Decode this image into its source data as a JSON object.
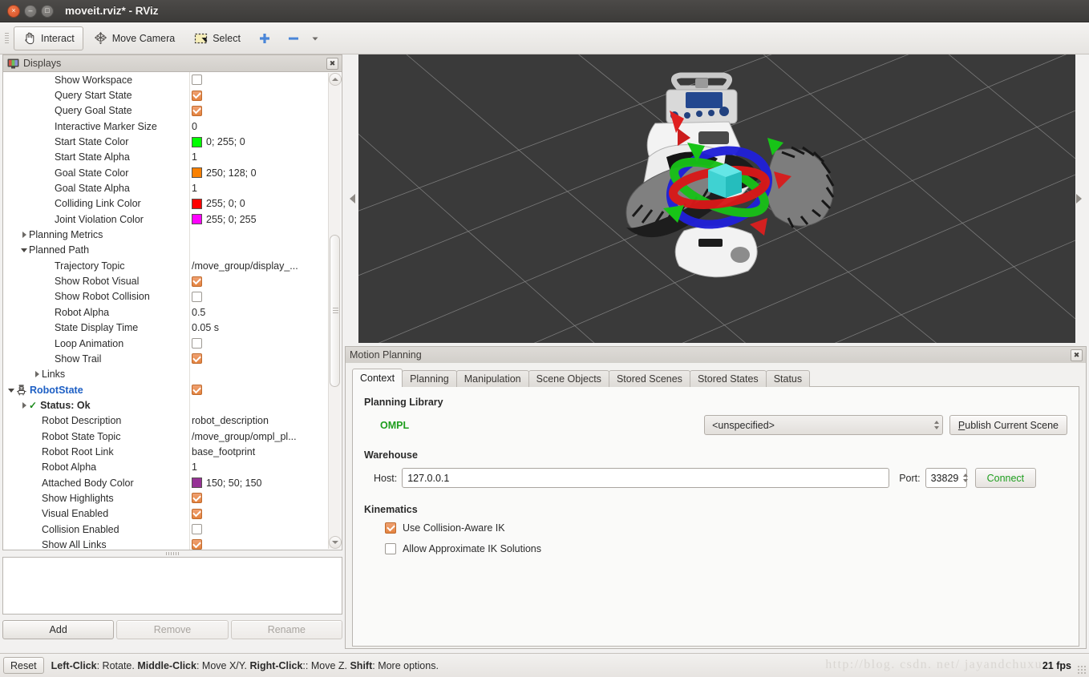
{
  "window": {
    "title": "moveit.rviz* - RViz",
    "close_label": "×",
    "minimize_label": "–",
    "maximize_label": "□"
  },
  "toolbar": {
    "interact_label": "Interact",
    "move_camera_label": "Move Camera",
    "select_label": "Select",
    "add_tool_label": "+",
    "remove_tool_label": "–",
    "dropdown_label": "▾"
  },
  "displays": {
    "panel_title": "Displays",
    "close_label": "✖",
    "value_divider_x": 232,
    "tree": [
      {
        "label": "Show Workspace",
        "indent": 3,
        "arrow": "none",
        "value_type": "checkbox",
        "checked": false
      },
      {
        "label": "Query Start State",
        "indent": 3,
        "arrow": "none",
        "value_type": "checkbox",
        "checked": true
      },
      {
        "label": "Query Goal State",
        "indent": 3,
        "arrow": "none",
        "value_type": "checkbox",
        "checked": true
      },
      {
        "label": "Interactive Marker Size",
        "indent": 3,
        "arrow": "none",
        "value_type": "text",
        "value": "0"
      },
      {
        "label": "Start State Color",
        "indent": 3,
        "arrow": "none",
        "value_type": "color",
        "value": "0; 255; 0",
        "color": "#00ff00"
      },
      {
        "label": "Start State Alpha",
        "indent": 3,
        "arrow": "none",
        "value_type": "text",
        "value": "1"
      },
      {
        "label": "Goal State Color",
        "indent": 3,
        "arrow": "none",
        "value_type": "color",
        "value": "250; 128; 0",
        "color": "#fa8000"
      },
      {
        "label": "Goal State Alpha",
        "indent": 3,
        "arrow": "none",
        "value_type": "text",
        "value": "1"
      },
      {
        "label": "Colliding Link Color",
        "indent": 3,
        "arrow": "none",
        "value_type": "color",
        "value": "255; 0; 0",
        "color": "#ff0000"
      },
      {
        "label": "Joint Violation Color",
        "indent": 3,
        "arrow": "none",
        "value_type": "color",
        "value": "255; 0; 255",
        "color": "#ff00ff"
      },
      {
        "label": "Planning Metrics",
        "indent": 1,
        "arrow": "closed",
        "value_type": "none"
      },
      {
        "label": "Planned Path",
        "indent": 1,
        "arrow": "open",
        "value_type": "none"
      },
      {
        "label": "Trajectory Topic",
        "indent": 3,
        "arrow": "none",
        "value_type": "text",
        "value": "/move_group/display_..."
      },
      {
        "label": "Show Robot Visual",
        "indent": 3,
        "arrow": "none",
        "value_type": "checkbox",
        "checked": true
      },
      {
        "label": "Show Robot Collision",
        "indent": 3,
        "arrow": "none",
        "value_type": "checkbox",
        "checked": false
      },
      {
        "label": "Robot Alpha",
        "indent": 3,
        "arrow": "none",
        "value_type": "text",
        "value": "0.5"
      },
      {
        "label": "State Display Time",
        "indent": 3,
        "arrow": "none",
        "value_type": "text",
        "value": "0.05 s"
      },
      {
        "label": "Loop Animation",
        "indent": 3,
        "arrow": "none",
        "value_type": "checkbox",
        "checked": false
      },
      {
        "label": "Show Trail",
        "indent": 3,
        "arrow": "none",
        "value_type": "checkbox",
        "checked": true
      },
      {
        "label": "Links",
        "indent": 2,
        "arrow": "closed",
        "value_type": "none"
      },
      {
        "label": "RobotState",
        "indent": 0,
        "arrow": "open",
        "value_type": "checkbox",
        "checked": true,
        "style": "display-root",
        "icon": "robot-icon"
      },
      {
        "label": "Status: Ok",
        "indent": 1,
        "arrow": "closed",
        "value_type": "none",
        "style": "status-ok"
      },
      {
        "label": "Robot Description",
        "indent": 2,
        "arrow": "none",
        "value_type": "text",
        "value": "robot_description"
      },
      {
        "label": "Robot State Topic",
        "indent": 2,
        "arrow": "none",
        "value_type": "text",
        "value": "/move_group/ompl_pl..."
      },
      {
        "label": "Robot Root Link",
        "indent": 2,
        "arrow": "none",
        "value_type": "text",
        "value": "base_footprint"
      },
      {
        "label": "Robot Alpha",
        "indent": 2,
        "arrow": "none",
        "value_type": "text",
        "value": "1"
      },
      {
        "label": "Attached Body Color",
        "indent": 2,
        "arrow": "none",
        "value_type": "color",
        "value": "150; 50; 150",
        "color": "#963296"
      },
      {
        "label": "Show Highlights",
        "indent": 2,
        "arrow": "none",
        "value_type": "checkbox",
        "checked": true
      },
      {
        "label": "Visual Enabled",
        "indent": 2,
        "arrow": "none",
        "value_type": "checkbox",
        "checked": true
      },
      {
        "label": "Collision Enabled",
        "indent": 2,
        "arrow": "none",
        "value_type": "checkbox",
        "checked": false
      },
      {
        "label": "Show All Links",
        "indent": 2,
        "arrow": "none",
        "value_type": "checkbox",
        "checked": true
      }
    ],
    "buttons": {
      "add": "Add",
      "remove": "Remove",
      "rename": "Rename"
    }
  },
  "motion_planning": {
    "panel_title": "Motion Planning",
    "close_label": "✖",
    "tabs": [
      {
        "label": "Context",
        "selected": true
      },
      {
        "label": "Planning",
        "selected": false
      },
      {
        "label": "Manipulation",
        "selected": false
      },
      {
        "label": "Scene Objects",
        "selected": false
      },
      {
        "label": "Stored Scenes",
        "selected": false
      },
      {
        "label": "Stored States",
        "selected": false
      },
      {
        "label": "Status",
        "selected": false
      }
    ],
    "context": {
      "planning_library_title": "Planning Library",
      "planner_name": "OMPL",
      "planner_color": "#1e9e1e",
      "planner_config_value": "<unspecified>",
      "publish_scene_button": "Publish Current Scene",
      "warehouse_title": "Warehouse",
      "host_label": "Host:",
      "host_value": "127.0.0.1",
      "port_label": "Port:",
      "port_value": "33829",
      "connect_button": "Connect",
      "connect_color": "#1e9e1e",
      "kinematics_title": "Kinematics",
      "use_collision_aware_ik_label": "Use Collision-Aware IK",
      "use_collision_aware_ik_checked": true,
      "allow_approximate_ik_label": "Allow Approximate IK Solutions",
      "allow_approximate_ik_checked": false
    }
  },
  "statusbar": {
    "reset_label": "Reset",
    "hint_parts": [
      {
        "text": "Left-Click",
        "bold": true
      },
      {
        "text": ": Rotate. ",
        "bold": false
      },
      {
        "text": "Middle-Click",
        "bold": true
      },
      {
        "text": ": Move X/Y. ",
        "bold": false
      },
      {
        "text": "Right-Click",
        "bold": true
      },
      {
        "text": ":: Move Z. ",
        "bold": false
      },
      {
        "text": "Shift",
        "bold": true
      },
      {
        "text": ": More options.",
        "bold": false
      }
    ],
    "fps": "21 fps",
    "watermark": "http://blog. csdn. net/ jayandchuxu"
  },
  "viewport": {
    "background_color": "#3a3a3a",
    "grid_color": "#8e8e8e",
    "left_handle": "◀",
    "right_handle": "▶"
  }
}
